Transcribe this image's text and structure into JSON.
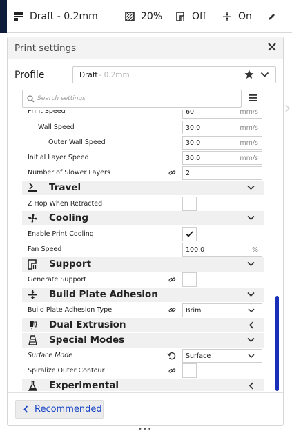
{
  "toolbar": {
    "profile": "Draft - 0.2mm",
    "infill": "20%",
    "support": "Off",
    "adhesion": "On"
  },
  "panel": {
    "title": "Print settings",
    "profile_label": "Profile",
    "profile_name": "Draft",
    "profile_suffix": " - 0.2mm",
    "search_placeholder": "Search settings"
  },
  "settings": {
    "print_speed": {
      "label": "Print Speed",
      "value": "60",
      "unit": "mm/s"
    },
    "wall_speed": {
      "label": "Wall Speed",
      "value": "30.0",
      "unit": "mm/s"
    },
    "outer_wall_speed": {
      "label": "Outer Wall Speed",
      "value": "30.0",
      "unit": "mm/s"
    },
    "initial_layer_speed": {
      "label": "Initial Layer Speed",
      "value": "30.0",
      "unit": "mm/s"
    },
    "slower_layers": {
      "label": "Number of Slower Layers",
      "value": "2"
    },
    "travel": {
      "label": "Travel"
    },
    "z_hop": {
      "label": "Z Hop When Retracted",
      "checked": false
    },
    "cooling": {
      "label": "Cooling"
    },
    "enable_cooling": {
      "label": "Enable Print Cooling",
      "checked": true
    },
    "fan_speed": {
      "label": "Fan Speed",
      "value": "100.0",
      "unit": "%"
    },
    "support": {
      "label": "Support"
    },
    "generate_support": {
      "label": "Generate Support",
      "checked": false
    },
    "adhesion": {
      "label": "Build Plate Adhesion"
    },
    "adhesion_type": {
      "label": "Build Plate Adhesion Type",
      "value": "Brim"
    },
    "dual_extrusion": {
      "label": "Dual Extrusion"
    },
    "special_modes": {
      "label": "Special Modes"
    },
    "surface_mode": {
      "label": "Surface Mode",
      "value": "Surface"
    },
    "spiralize": {
      "label": "Spiralize Outer Contour",
      "checked": false
    },
    "experimental": {
      "label": "Experimental"
    }
  },
  "footer": {
    "recommended_label": "Recommended"
  },
  "colors": {
    "accent": "#1a46c8",
    "scrollbar": "#1a2fb8",
    "category_bg": "#f0f0f0"
  }
}
